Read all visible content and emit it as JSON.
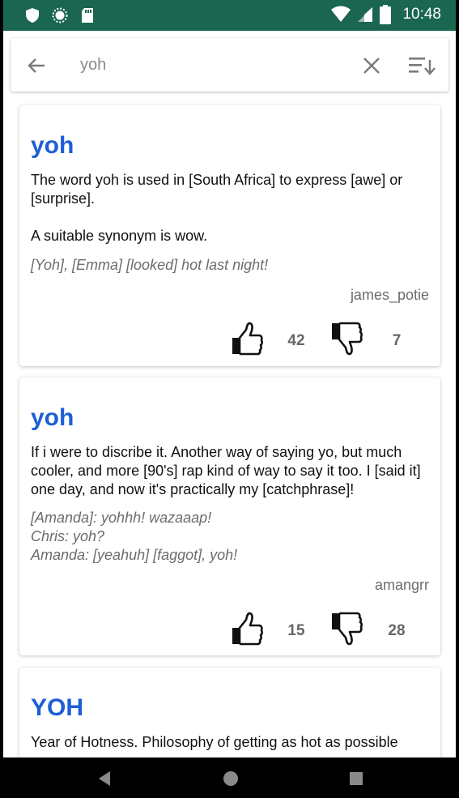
{
  "status_bar": {
    "time": "10:48",
    "left_icons": [
      "shield-icon",
      "circle-sync-icon",
      "sd-card-icon"
    ],
    "right_icons": [
      "wifi-icon",
      "signal-icon",
      "battery-icon"
    ],
    "background": "#1a6651"
  },
  "search": {
    "query": "yoh",
    "back_icon": "arrow-left-icon",
    "clear_icon": "close-icon",
    "sort_icon": "sort-icon"
  },
  "accent_color": "#1c5fd6",
  "definitions": [
    {
      "word": "yoh",
      "definition": "The word yoh is used in [South Africa] to express [awe] or [surprise].\n\nA suitable synonym is wow.",
      "example": "[Yoh], [Emma] [looked] hot last night!",
      "author": "james_potie",
      "thumbs_up": "42",
      "thumbs_down": "7"
    },
    {
      "word": "yoh",
      "definition": "If i were to discribe it. Another way of saying yo, but much cooler, and more [90's] rap kind of way to say it too. I [said it] one day, and now it's practically my [catchphrase]!",
      "example": "[Amanda]: yohhh! wazaaap!\nChris: yoh?\nAmanda: [yeahuh] [faggot], yoh!",
      "author": "amangrr",
      "thumbs_up": "15",
      "thumbs_down": "28"
    },
    {
      "word": "YOH",
      "definition": "Year of Hotness. Philosophy of getting as hot as possible"
    }
  ],
  "nav_bar": {
    "icons": [
      "nav-back-icon",
      "nav-home-icon",
      "nav-recents-icon"
    ]
  }
}
